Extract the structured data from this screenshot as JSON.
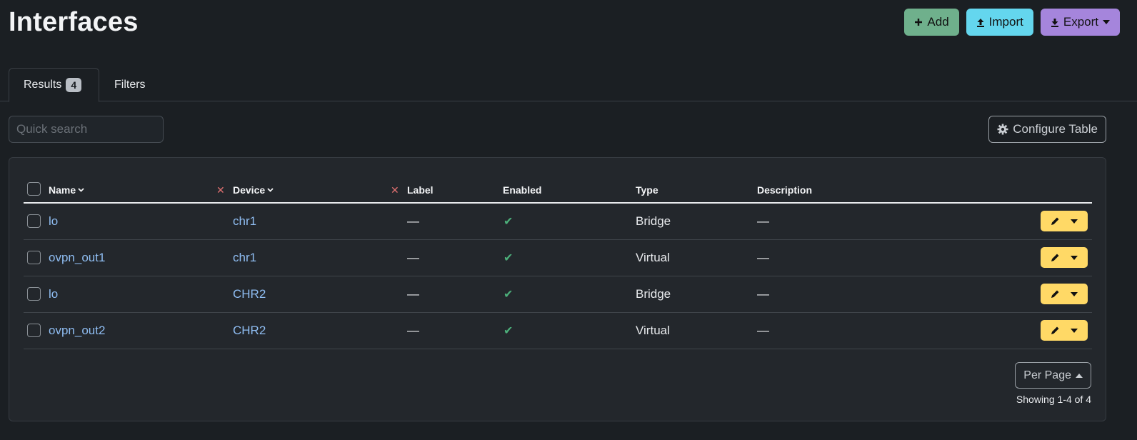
{
  "page": {
    "title": "Interfaces"
  },
  "actions": {
    "add_label": "Add",
    "import_label": "Import",
    "export_label": "Export"
  },
  "tabs": {
    "results_label": "Results",
    "results_count": "4",
    "filters_label": "Filters"
  },
  "search": {
    "placeholder": "Quick search"
  },
  "configure_table_label": "Configure Table",
  "table": {
    "columns": {
      "name": "Name",
      "device": "Device",
      "label": "Label",
      "enabled": "Enabled",
      "type": "Type",
      "description": "Description"
    },
    "rows": [
      {
        "name": "lo",
        "device": "chr1",
        "label": "—",
        "enabled": "✔",
        "type": "Bridge",
        "description": "—"
      },
      {
        "name": "ovpn_out1",
        "device": "chr1",
        "label": "—",
        "enabled": "✔",
        "type": "Virtual",
        "description": "—"
      },
      {
        "name": "lo",
        "device": "CHR2",
        "label": "—",
        "enabled": "✔",
        "type": "Bridge",
        "description": "—"
      },
      {
        "name": "ovpn_out2",
        "device": "CHR2",
        "label": "—",
        "enabled": "✔",
        "type": "Virtual",
        "description": "—"
      }
    ]
  },
  "pagination": {
    "per_page_label": "Per Page",
    "showing": "Showing 1-4 of 4"
  },
  "colors": {
    "add": "#6fb08c",
    "import": "#64d6ee",
    "export": "#a585dc",
    "edit": "#ffd966",
    "link": "#8fbdf2"
  }
}
